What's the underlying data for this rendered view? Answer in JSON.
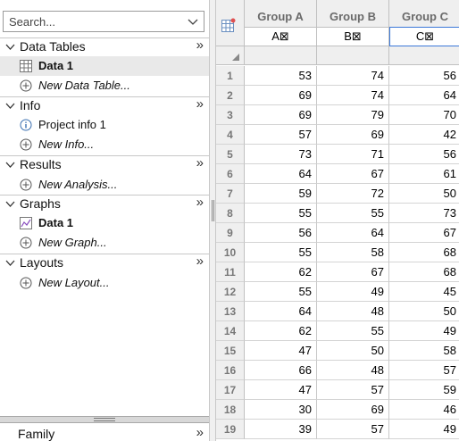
{
  "search": {
    "placeholder": "Search..."
  },
  "sections": [
    {
      "title": "Data Tables",
      "items": [
        {
          "icon": "data-table-icon",
          "label": "Data 1",
          "bold": true,
          "selected": true
        },
        {
          "icon": "add-icon",
          "label": "New Data Table...",
          "italic": true
        }
      ]
    },
    {
      "title": "Info",
      "items": [
        {
          "icon": "info-icon",
          "label": "Project info 1"
        },
        {
          "icon": "add-icon",
          "label": "New Info...",
          "italic": true
        }
      ]
    },
    {
      "title": "Results",
      "items": [
        {
          "icon": "add-icon",
          "label": "New Analysis...",
          "italic": true
        }
      ]
    },
    {
      "title": "Graphs",
      "items": [
        {
          "icon": "graph-icon",
          "label": "Data 1",
          "bold": true
        },
        {
          "icon": "add-icon",
          "label": "New Graph...",
          "italic": true
        }
      ]
    },
    {
      "title": "Layouts",
      "items": [
        {
          "icon": "add-icon",
          "label": "New Layout...",
          "italic": true
        }
      ]
    }
  ],
  "family": {
    "title": "Family",
    "expand": "»"
  },
  "expand_symbol": "»",
  "columns": [
    {
      "name": "Group A",
      "sub": "A⊠"
    },
    {
      "name": "Group B",
      "sub": "B⊠"
    },
    {
      "name": "Group C",
      "sub": "C⊠"
    }
  ],
  "rows": [
    {
      "n": "1",
      "v": [
        "53",
        "74",
        "56"
      ]
    },
    {
      "n": "2",
      "v": [
        "69",
        "74",
        "64"
      ]
    },
    {
      "n": "3",
      "v": [
        "69",
        "79",
        "70"
      ]
    },
    {
      "n": "4",
      "v": [
        "57",
        "69",
        "42"
      ]
    },
    {
      "n": "5",
      "v": [
        "73",
        "71",
        "56"
      ]
    },
    {
      "n": "6",
      "v": [
        "64",
        "67",
        "61"
      ]
    },
    {
      "n": "7",
      "v": [
        "59",
        "72",
        "50"
      ]
    },
    {
      "n": "8",
      "v": [
        "55",
        "55",
        "73"
      ]
    },
    {
      "n": "9",
      "v": [
        "56",
        "64",
        "67"
      ]
    },
    {
      "n": "10",
      "v": [
        "55",
        "58",
        "68"
      ]
    },
    {
      "n": "11",
      "v": [
        "62",
        "67",
        "68"
      ]
    },
    {
      "n": "12",
      "v": [
        "55",
        "49",
        "45"
      ]
    },
    {
      "n": "13",
      "v": [
        "64",
        "48",
        "50"
      ]
    },
    {
      "n": "14",
      "v": [
        "62",
        "55",
        "49"
      ]
    },
    {
      "n": "15",
      "v": [
        "47",
        "50",
        "58"
      ]
    },
    {
      "n": "16",
      "v": [
        "66",
        "48",
        "57"
      ]
    },
    {
      "n": "17",
      "v": [
        "47",
        "57",
        "59"
      ]
    },
    {
      "n": "18",
      "v": [
        "30",
        "69",
        "46"
      ]
    },
    {
      "n": "19",
      "v": [
        "39",
        "57",
        "49"
      ]
    }
  ]
}
